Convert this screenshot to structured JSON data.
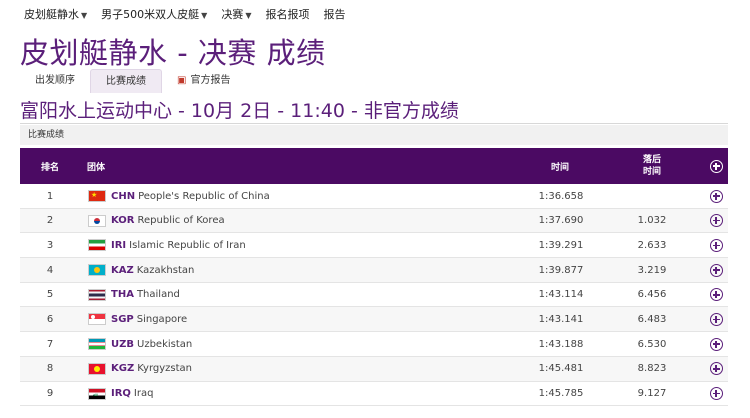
{
  "nav": {
    "items": [
      {
        "label": "皮划艇静水",
        "dropdown": true
      },
      {
        "label": "男子500米双人皮艇",
        "dropdown": true
      },
      {
        "label": "决赛",
        "dropdown": true
      },
      {
        "label": "报名报项",
        "dropdown": false
      },
      {
        "label": "报告",
        "dropdown": false
      }
    ]
  },
  "page": {
    "title": "皮划艇静水 - 决赛 成绩",
    "venue": "富阳水上运动中心 - 10月 2日 - 11:40 - 非官方成绩",
    "section": "比赛成绩"
  },
  "tabs": {
    "start_list": "出发顺序",
    "results": "比赛成绩",
    "official_report": "官方报告"
  },
  "table": {
    "headers": {
      "rank": "排名",
      "team": "团体",
      "time": "时间",
      "behind_1": "落后",
      "behind_2": "时间"
    },
    "rows": [
      {
        "rank": "1",
        "code": "CHN",
        "name": "People's Republic of China",
        "time": "1:36.658",
        "behind": "",
        "flag": "china-flag-icon"
      },
      {
        "rank": "2",
        "code": "KOR",
        "name": "Republic of Korea",
        "time": "1:37.690",
        "behind": "1.032",
        "flag": "korea-flag-icon"
      },
      {
        "rank": "3",
        "code": "IRI",
        "name": "Islamic Republic of Iran",
        "time": "1:39.291",
        "behind": "2.633",
        "flag": "iran-flag-icon"
      },
      {
        "rank": "4",
        "code": "KAZ",
        "name": "Kazakhstan",
        "time": "1:39.877",
        "behind": "3.219",
        "flag": "kazakhstan-flag-icon"
      },
      {
        "rank": "5",
        "code": "THA",
        "name": "Thailand",
        "time": "1:43.114",
        "behind": "6.456",
        "flag": "thailand-flag-icon"
      },
      {
        "rank": "6",
        "code": "SGP",
        "name": "Singapore",
        "time": "1:43.141",
        "behind": "6.483",
        "flag": "singapore-flag-icon"
      },
      {
        "rank": "7",
        "code": "UZB",
        "name": "Uzbekistan",
        "time": "1:43.188",
        "behind": "6.530",
        "flag": "uzbekistan-flag-icon"
      },
      {
        "rank": "8",
        "code": "KGZ",
        "name": "Kyrgyzstan",
        "time": "1:45.481",
        "behind": "8.823",
        "flag": "kyrgyzstan-flag-icon"
      },
      {
        "rank": "9",
        "code": "IRQ",
        "name": "Iraq",
        "time": "1:45.785",
        "behind": "9.127",
        "flag": "iraq-flag-icon"
      }
    ]
  },
  "colors": {
    "accent": "#5b1f7a",
    "header_bg": "#4b0a63"
  }
}
